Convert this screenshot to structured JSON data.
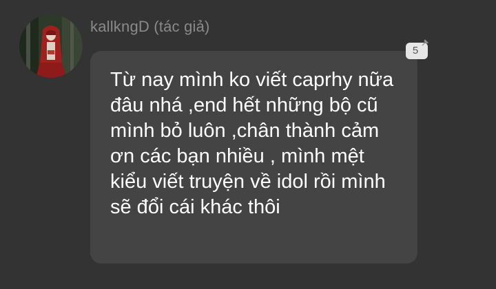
{
  "comment": {
    "author": "kallkngD (tác giả)",
    "text": "Từ nay mình ko viết caprhy nữa đâu nhá ,end hết những bộ cũ mình bỏ luôn ,chân thành cảm ơn các bạn nhiều , mình mệt kiểu viết truyện về idol rồi mình sẽ đổi cái khác thôi",
    "reaction_count": "5",
    "reaction_icon": "pin-icon"
  },
  "colors": {
    "background": "#333333",
    "bubble": "#444444",
    "author_text": "#8a8a8a",
    "body_text": "#ffffff",
    "badge_bg": "#e6e6e6"
  }
}
